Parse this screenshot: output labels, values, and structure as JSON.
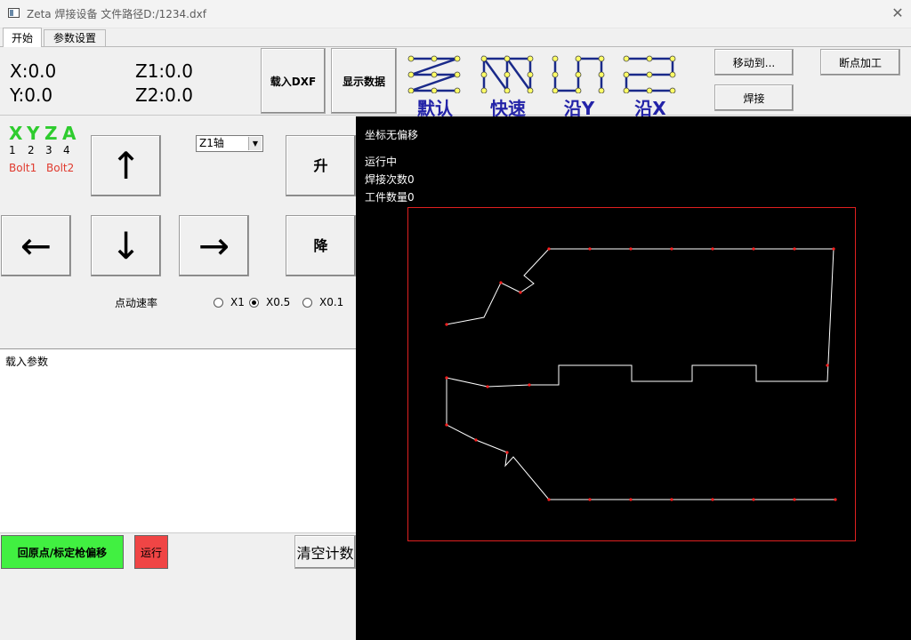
{
  "window": {
    "title": "Zeta 焊接设备 文件路径D:/1234.dxf",
    "close_glyph": "✕"
  },
  "tabs": [
    {
      "label": "开始",
      "active": true
    },
    {
      "label": "参数设置",
      "active": false
    }
  ],
  "coords": {
    "x": "X:0.0",
    "y": "Y:0.0",
    "z1": "Z1:0.0",
    "z2": "Z2:0.0"
  },
  "toolbar": {
    "load_dxf": "载入DXF",
    "show_data": "显示数据",
    "patterns": [
      {
        "label": "默认"
      },
      {
        "label": "快速"
      },
      {
        "label": "沿Y"
      },
      {
        "label": "沿X"
      }
    ],
    "move_to": "移动到...",
    "weld": "焊接",
    "resume": "断点加工"
  },
  "axes": {
    "letters": [
      "X",
      "Y",
      "Z",
      "A"
    ],
    "numbers": [
      "1",
      "2",
      "3",
      "4"
    ],
    "bolts": [
      "Bolt1",
      "Bolt2"
    ],
    "letter_color": "#2ecc2e",
    "bolt_color": "#e03a2e"
  },
  "jog": {
    "up": "↑",
    "down": "↓",
    "left": "←",
    "right": "→",
    "raise": "升",
    "lower": "降"
  },
  "axis_select": {
    "value": "Z1轴"
  },
  "speed": {
    "label": "点动速率",
    "options": [
      {
        "label": "X1",
        "selected": false
      },
      {
        "label": "X0.5",
        "selected": true
      },
      {
        "label": "X0.1",
        "selected": false
      }
    ]
  },
  "log": {
    "text": "载入参数"
  },
  "actions": {
    "home": "回原点/标定枪偏移",
    "run": "运行",
    "clear": "清空计数",
    "home_color": "#41f041",
    "run_color": "#f04545"
  },
  "canvas": {
    "offset_status": "坐标无偏移",
    "run_status": "运行中",
    "weld_count": "焊接次数0",
    "part_count": "工件数量0",
    "border_color": "#e02020",
    "path_color": "#ffffff",
    "point_color": "#ff2020"
  }
}
